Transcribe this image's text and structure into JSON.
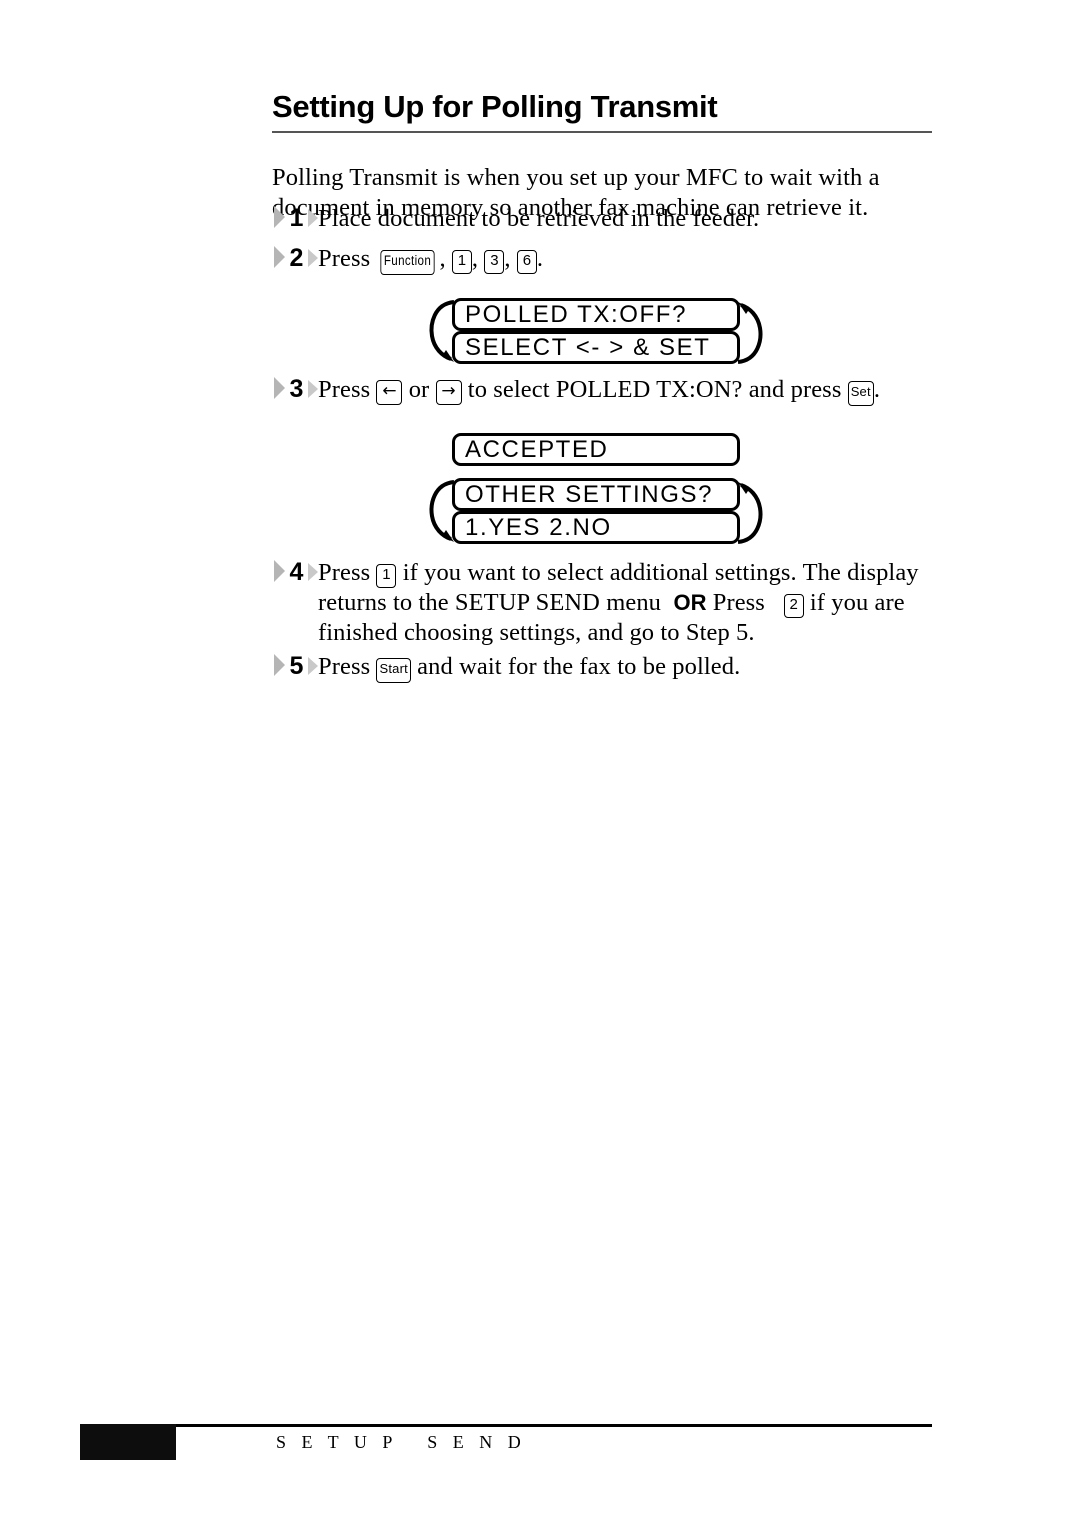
{
  "document": {
    "title": "Setting Up for Polling Transmit",
    "intro": "Polling Transmit is when you set up your MFC to wait with a document in memory so another fax machine can retrieve it."
  },
  "steps": [
    {
      "number": "1",
      "text": "Place document to be retrieved in the feeder."
    },
    {
      "number": "2",
      "lead": "Press",
      "keys": [
        "Function",
        "1",
        "3",
        "6"
      ],
      "tail": "."
    },
    {
      "number": "3",
      "lead": "Press",
      "key_left_arrow": "←",
      "mid_or": "or",
      "key_right_arrow": "→",
      "mid_text": "to select POLLED TX:ON? and press",
      "key_set": "Set",
      "tail": "."
    },
    {
      "number": "4",
      "part1": "Press",
      "key_1": "1",
      "part2": "if you want to select additional settings. The display returns to the SETUP SEND menu",
      "or_label": "OR",
      "part3": "Press",
      "key_2": "2",
      "part4": "if you are finished choosing settings, and go to Step 5."
    },
    {
      "number": "5",
      "lead": "Press",
      "key_start": "Start",
      "tail": "and wait for the fax to be polled."
    }
  ],
  "displays": {
    "polling_prompt": {
      "line1": "POLLED TX:OFF?",
      "line2": "SELECT <- > & SET",
      "has_loop_arrows": true
    },
    "accepted": {
      "line1": "ACCEPTED",
      "has_loop_arrows": false
    },
    "other_settings": {
      "line1": "OTHER SETTINGS?",
      "line2": "1.YES 2.NO",
      "has_loop_arrows": true
    }
  },
  "footer": {
    "label": "S E T U P   S E N D"
  },
  "colors": {
    "ink": "#000000",
    "page": "#ffffff",
    "rule": "#555555",
    "marker": "#b5b5b5"
  }
}
